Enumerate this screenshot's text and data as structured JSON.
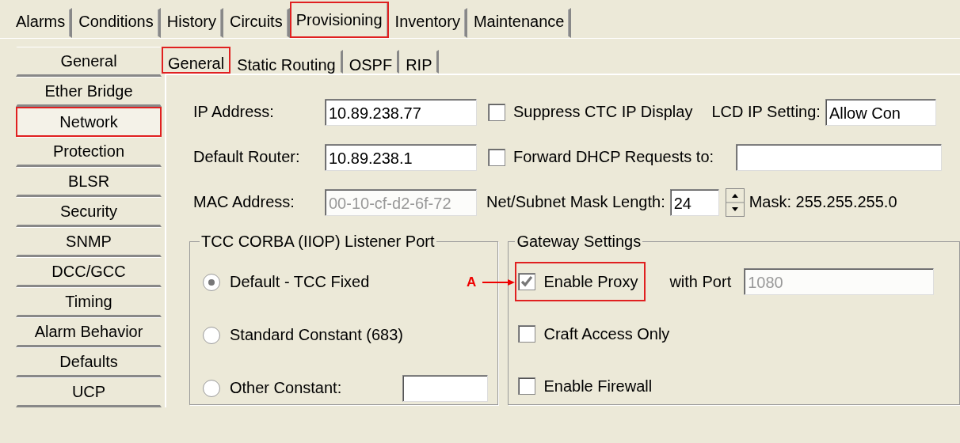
{
  "tabs": [
    {
      "label": "Alarms",
      "selected": false,
      "highlighted": false
    },
    {
      "label": "Conditions",
      "selected": false,
      "highlighted": false
    },
    {
      "label": "History",
      "selected": false,
      "highlighted": false
    },
    {
      "label": "Circuits",
      "selected": false,
      "highlighted": false
    },
    {
      "label": "Provisioning",
      "selected": true,
      "highlighted": true
    },
    {
      "label": "Inventory",
      "selected": false,
      "highlighted": false
    },
    {
      "label": "Maintenance",
      "selected": false,
      "highlighted": false
    }
  ],
  "sidebar": {
    "items": [
      {
        "label": "General",
        "selected": false,
        "highlighted": false
      },
      {
        "label": "Ether Bridge",
        "selected": false,
        "highlighted": false
      },
      {
        "label": "Network",
        "selected": true,
        "highlighted": true
      },
      {
        "label": "Protection",
        "selected": false,
        "highlighted": false
      },
      {
        "label": "BLSR",
        "selected": false,
        "highlighted": false
      },
      {
        "label": "Security",
        "selected": false,
        "highlighted": false
      },
      {
        "label": "SNMP",
        "selected": false,
        "highlighted": false
      },
      {
        "label": "DCC/GCC",
        "selected": false,
        "highlighted": false
      },
      {
        "label": "Timing",
        "selected": false,
        "highlighted": false
      },
      {
        "label": "Alarm Behavior",
        "selected": false,
        "highlighted": false
      },
      {
        "label": "Defaults",
        "selected": false,
        "highlighted": false
      },
      {
        "label": "UCP",
        "selected": false,
        "highlighted": false
      }
    ]
  },
  "subtabs": [
    {
      "label": "General",
      "selected": true,
      "highlighted": true
    },
    {
      "label": "Static Routing",
      "selected": false,
      "highlighted": false
    },
    {
      "label": "OSPF",
      "selected": false,
      "highlighted": false
    },
    {
      "label": "RIP",
      "selected": false,
      "highlighted": false
    }
  ],
  "network": {
    "ip_address": {
      "label": "IP Address:",
      "value": "10.89.238.77"
    },
    "suppress_ctc": {
      "label": "Suppress CTC IP Display",
      "checked": false
    },
    "lcd_ip_setting": {
      "label": "LCD IP Setting:",
      "value": "Allow Con"
    },
    "default_router": {
      "label": "Default Router:",
      "value": "10.89.238.1"
    },
    "forward_dhcp": {
      "label": "Forward DHCP Requests to:",
      "checked": false
    },
    "mac_address": {
      "label": "MAC Address:",
      "value": "00-10-cf-d2-6f-72",
      "disabled": true
    },
    "mask_length": {
      "label": "Net/Subnet Mask Length:",
      "value": "24"
    },
    "mask": "Mask: 255.255.255.0"
  },
  "listener_port": {
    "title": "TCC CORBA (IIOP) Listener Port",
    "options": [
      {
        "label": "Default - TCC Fixed",
        "selected": true,
        "kind": "plain"
      },
      {
        "label": "Standard Constant (683)",
        "selected": false,
        "kind": "plain"
      },
      {
        "label": "Other Constant:",
        "selected": false,
        "kind": "with_field"
      }
    ]
  },
  "gateway": {
    "title": "Gateway Settings",
    "options": [
      {
        "label": "Enable Proxy",
        "checked": true,
        "highlighted": true,
        "kind": "with_port"
      },
      {
        "label": "Craft Access Only",
        "checked": false,
        "highlighted": false,
        "kind": "plain"
      },
      {
        "label": "Enable Firewall",
        "checked": false,
        "highlighted": false,
        "kind": "plain"
      }
    ],
    "port": {
      "label": "with Port",
      "value": "1080",
      "disabled": true
    }
  },
  "annotation": {
    "label": "A"
  }
}
